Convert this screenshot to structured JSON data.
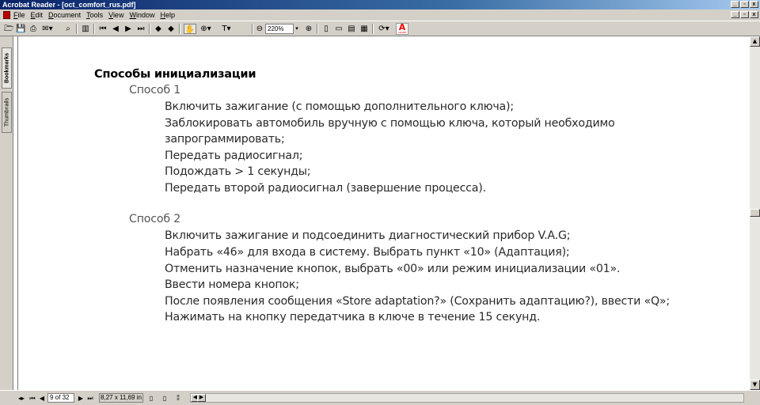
{
  "window": {
    "title": "Acrobat Reader - [oct_comfort_rus.pdf]",
    "controls": [
      "_",
      "▫",
      "x"
    ]
  },
  "menubar": {
    "items": [
      "File",
      "Edit",
      "Document",
      "Tools",
      "View",
      "Window",
      "Help"
    ],
    "doc_controls": [
      "_",
      "▫",
      "x"
    ]
  },
  "toolbar": {
    "zoom_value": "220%",
    "icons": [
      "open-icon",
      "save-icon",
      "print-icon",
      "email-icon",
      "find-icon",
      "show-navigation-pane-icon",
      "first-page-icon",
      "previous-page-icon",
      "next-page-icon",
      "last-page-icon",
      "go-back-icon",
      "go-forward-icon",
      "hand-tool-icon",
      "zoom-tool-icon",
      "text-select-tool-icon",
      "zoom-out-icon",
      "zoom-in-icon",
      "actual-size-icon",
      "fit-page-icon",
      "fit-width-icon",
      "rotate-icon",
      "adobe-logo-icon"
    ]
  },
  "navpane": {
    "tabs": [
      "Bookmarks",
      "Thumbnails"
    ]
  },
  "document": {
    "heading": "Способы инициализации",
    "method1": {
      "title": "Способ 1",
      "lines": [
        "Включить зажигание (с помощью дополнительного ключа);",
        "Заблокировать автомобиль вручную с помощью ключа, который необходимо",
        "запрограммировать;",
        "Передать радиосигнал;",
        "Подождать > 1 секунды;",
        "Передать второй радиосигнал (завершение процесса)."
      ]
    },
    "method2": {
      "title": "Способ 2",
      "lines": [
        "Включить зажигание и подсоединить диагностический прибор V.A.G;",
        "Набрать «46» для входа в систему. Выбрать пункт «10» (Адаптация);",
        "Отменить назначение кнопок, выбрать «00» или режим инициализации «01».",
        "Ввести номера кнопок;",
        "После появления сообщения «Store adaptation?» (Сохранить адаптацию?), ввести «Q»;",
        "Нажимать на кнопку передатчика в ключе в течение 15 секунд."
      ]
    }
  },
  "statusbar": {
    "page_indicator": "9 of 32",
    "page_size": "8,27 x 11,69 in"
  }
}
